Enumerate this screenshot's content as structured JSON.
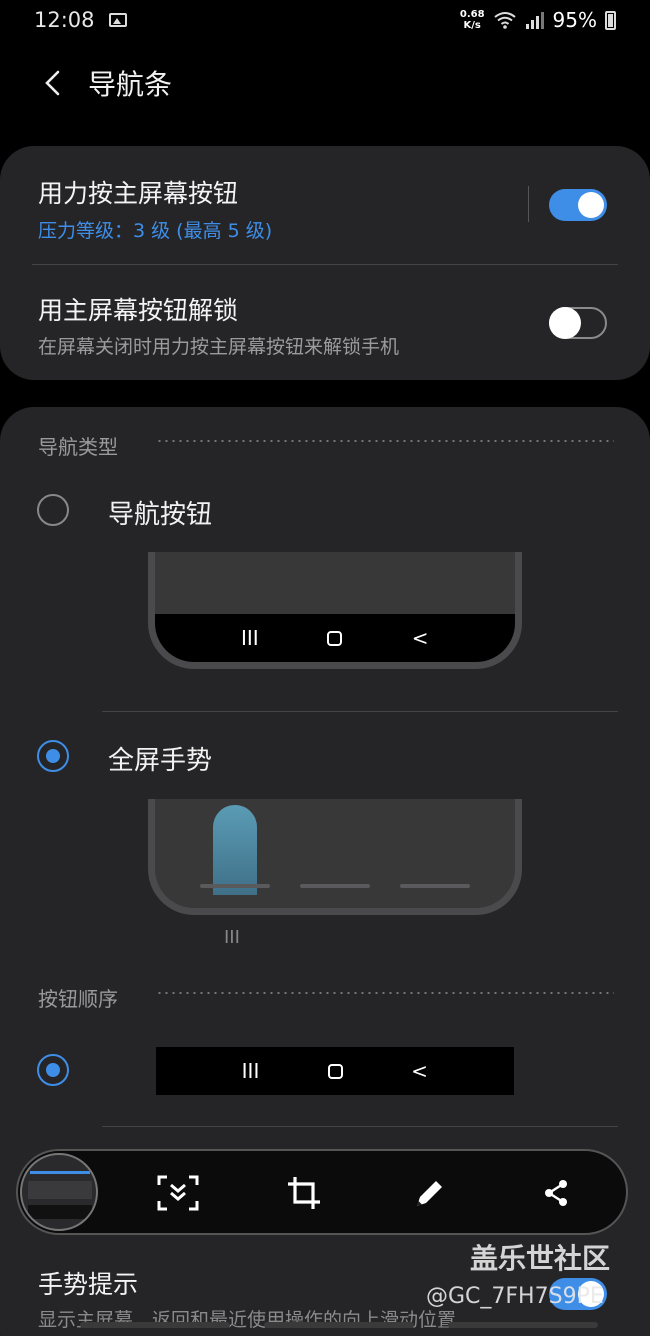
{
  "status_bar": {
    "time": "12:08",
    "net_speed_value": "0.68",
    "net_speed_unit": "K/s",
    "battery": "95%"
  },
  "header": {
    "title": "导航条"
  },
  "settings": {
    "press_home": {
      "title": "用力按主屏幕按钮",
      "subtitle": "压力等级：3 级 (最高 5 级)",
      "enabled": true
    },
    "unlock_home": {
      "title": "用主屏幕按钮解锁",
      "subtitle": "在屏幕关闭时用力按主屏幕按钮来解锁手机",
      "enabled": false
    }
  },
  "nav_type": {
    "header": "导航类型",
    "options": [
      {
        "label": "导航按钮",
        "selected": false
      },
      {
        "label": "全屏手势",
        "selected": true
      }
    ],
    "recents_glyph": "III",
    "back_glyph": "<"
  },
  "button_order": {
    "header": "按钮顺序"
  },
  "toolbar": {
    "icons": [
      "smart-select-icon",
      "crop-icon",
      "pen-icon",
      "share-icon"
    ]
  },
  "gesture_hint": {
    "title": "手势提示",
    "subtitle": "显示主屏幕、返回和最近使用操作的向上滑动位置",
    "enabled": true
  },
  "watermark": {
    "line1": "盖乐世社区",
    "line2": "@GC_7FH7S9PE"
  },
  "colors": {
    "accent": "#3e8ee8",
    "card": "#252527",
    "background": "#000000"
  }
}
